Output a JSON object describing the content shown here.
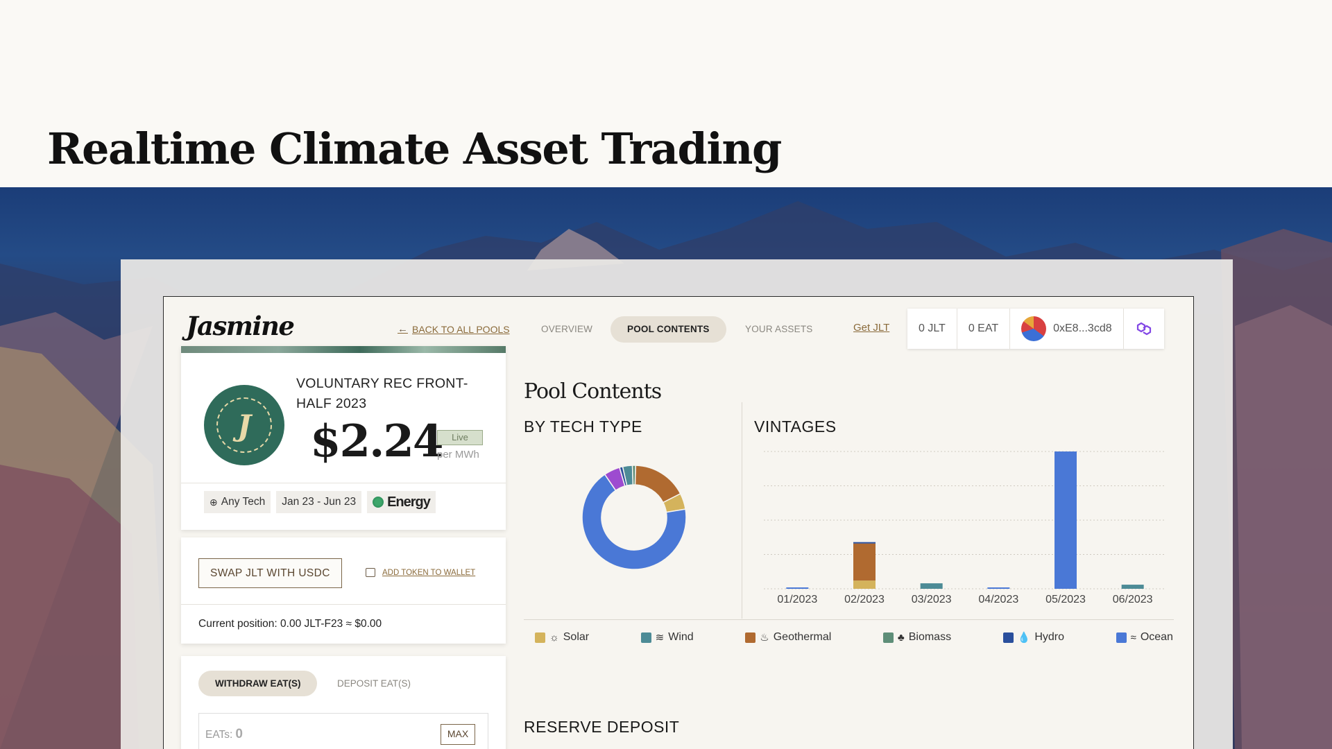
{
  "hero": {
    "title": "Realtime Climate Asset Trading"
  },
  "app": {
    "logo": "Jasmine",
    "nav": {
      "back": "BACK TO ALL POOLS",
      "tabs": [
        "OVERVIEW",
        "POOL CONTENTS",
        "YOUR ASSETS"
      ],
      "active_tab": "POOL CONTENTS"
    },
    "wallet": {
      "get_jlt": "Get JLT",
      "jlt_balance": "0 JLT",
      "eat_balance": "0 EAT",
      "address": "0xE8...3cd8"
    }
  },
  "pool": {
    "name": "VOLUNTARY REC FRONT-HALF 2023",
    "price": "$2.24",
    "live": "Live",
    "unit": "per MWh",
    "chips": {
      "tech": "Any Tech",
      "dates": "Jan 23 - Jun 23",
      "cert": "Energy"
    }
  },
  "swap": {
    "button": "SWAP JLT WITH USDC",
    "add_token": "ADD TOKEN TO WALLET",
    "position": "Current position: 0.00 JLT-F23 ≈ $0.00"
  },
  "withdraw": {
    "tab_active": "WITHDRAW EAT(S)",
    "tab_other": "DEPOSIT EAT(S)",
    "input_label": "EATs:",
    "input_value": "0",
    "max": "MAX"
  },
  "contents": {
    "title": "Pool Contents",
    "by_tech_heading": "BY TECH TYPE",
    "vintages_heading": "VINTAGES",
    "reserve_heading": "RESERVE DEPOSIT"
  },
  "legend": [
    {
      "label": "Solar",
      "color": "#d4b35c",
      "icon": "sun-icon",
      "glyph": "☼"
    },
    {
      "label": "Wind",
      "color": "#4d8b96",
      "icon": "wind-icon",
      "glyph": "≋"
    },
    {
      "label": "Geothermal",
      "color": "#b06a30",
      "icon": "geothermal-icon",
      "glyph": "♨"
    },
    {
      "label": "Biomass",
      "color": "#5e8e78",
      "icon": "sprout-icon",
      "glyph": "♣"
    },
    {
      "label": "Hydro",
      "color": "#2a4f9c",
      "icon": "droplet-icon",
      "glyph": "💧"
    },
    {
      "label": "Ocean",
      "color": "#4a78d6",
      "icon": "waves-icon",
      "glyph": "≈"
    }
  ],
  "chart_data": [
    {
      "type": "pie",
      "title": "BY TECH TYPE",
      "labels": [
        "Ocean",
        "Geothermal",
        "Solar",
        "Wind",
        "Biomass",
        "Hydro",
        "Other"
      ],
      "values": [
        68,
        17,
        5,
        3,
        1,
        1,
        5
      ],
      "colors": [
        "#4a78d6",
        "#b06a30",
        "#d4b35c",
        "#4d8b96",
        "#5e8e78",
        "#2a4f9c",
        "#9d4bd0"
      ]
    },
    {
      "type": "bar",
      "title": "VINTAGES",
      "categories": [
        "01/2023",
        "02/2023",
        "03/2023",
        "04/2023",
        "05/2023",
        "06/2023"
      ],
      "series": [
        {
          "name": "Solar",
          "color": "#d4b35c",
          "values": [
            0,
            6,
            0,
            0,
            0,
            0
          ]
        },
        {
          "name": "Geothermal",
          "color": "#b06a30",
          "values": [
            0,
            27,
            0,
            0,
            0,
            0
          ]
        },
        {
          "name": "Hydro",
          "color": "#2a4f9c",
          "values": [
            0,
            1,
            0,
            0,
            0,
            0
          ]
        },
        {
          "name": "Wind",
          "color": "#4d8b96",
          "values": [
            0,
            0,
            4,
            0,
            0,
            3
          ]
        },
        {
          "name": "Ocean",
          "color": "#4a78d6",
          "values": [
            1,
            0,
            0,
            1,
            100,
            0
          ]
        }
      ],
      "ylim": [
        0,
        100
      ]
    }
  ]
}
